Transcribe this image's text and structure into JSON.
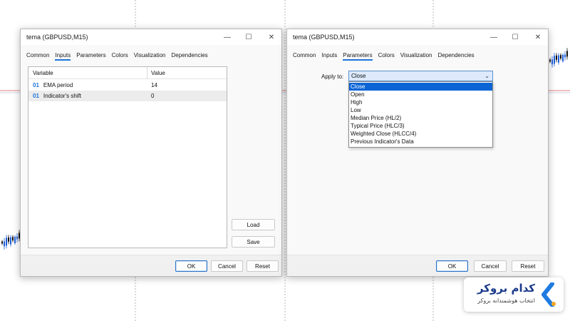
{
  "dialog_left": {
    "title": "tema (GBPUSD,M15)",
    "tabs": [
      "Common",
      "Inputs",
      "Parameters",
      "Colors",
      "Visualization",
      "Dependencies"
    ],
    "active_tab": "Inputs",
    "grid": {
      "headers": [
        "Variable",
        "Value"
      ],
      "rows": [
        {
          "type": "01",
          "variable": "EMA period",
          "value": "14"
        },
        {
          "type": "01",
          "variable": "Indicator's shift",
          "value": "0"
        }
      ]
    },
    "side_buttons": {
      "load": "Load",
      "save": "Save"
    },
    "footer": {
      "ok": "OK",
      "cancel": "Cancel",
      "reset": "Reset"
    }
  },
  "dialog_right": {
    "title": "tema (GBPUSD,M15)",
    "tabs": [
      "Common",
      "Inputs",
      "Parameters",
      "Colors",
      "Visualization",
      "Dependencies"
    ],
    "active_tab": "Parameters",
    "apply_to": {
      "label": "Apply to:",
      "value": "Close",
      "options": [
        "Close",
        "Open",
        "High",
        "Low",
        "Median Price (HL/2)",
        "Typical Price (HLC/3)",
        "Weighted Close (HLCC/4)",
        "Previous Indicator's Data"
      ],
      "selected": "Close"
    },
    "footer": {
      "ok": "OK",
      "cancel": "Cancel",
      "reset": "Reset"
    }
  },
  "brand": {
    "name": "کدام بروکر",
    "tagline": "انتخاب هوشمندانه بروکر",
    "colors": {
      "primary": "#1b3a8c",
      "accent": "#1e7be0",
      "dot": "#f5a623"
    }
  },
  "colors": {
    "accent": "#1e73d8",
    "selection": "#0a64d6",
    "candle_up": "#1f5fd6",
    "candle_down": "#111111",
    "price_line": "#d9534f"
  },
  "icons": {
    "minimize": "minimize-icon",
    "maximize": "maximize-icon",
    "close": "close-icon",
    "dropdown": "chevron-down-icon"
  }
}
